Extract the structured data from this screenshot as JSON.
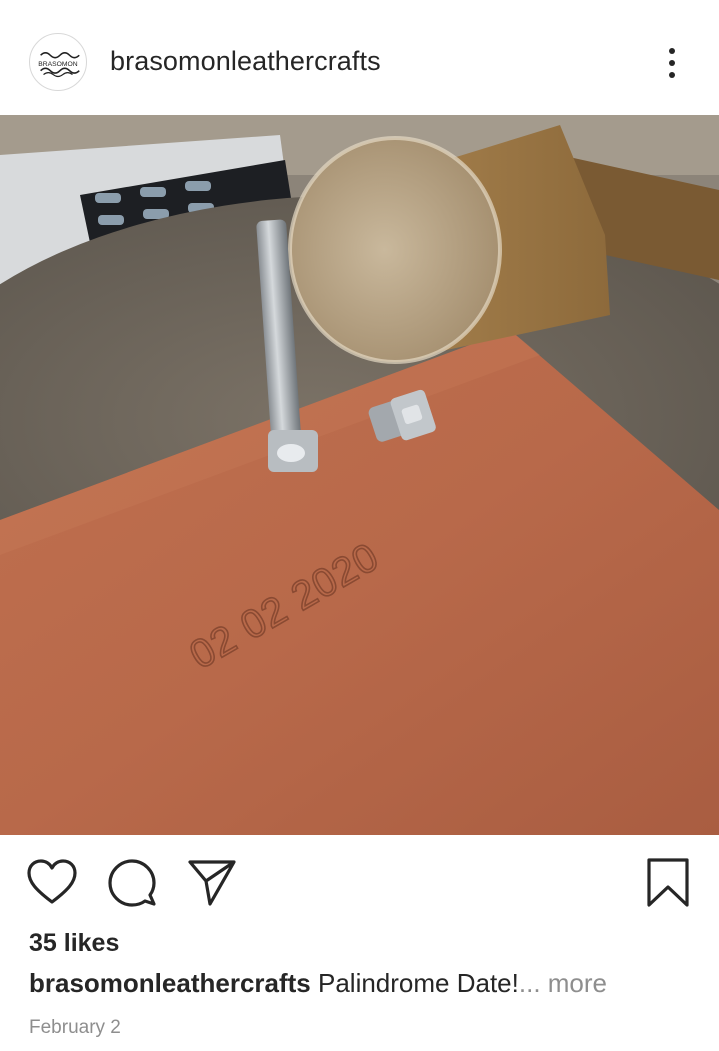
{
  "post": {
    "username": "brasomonleathercrafts",
    "avatar_text": "BRASOMON",
    "photo_stamp_text": "02 02 2020",
    "likes": "35 likes",
    "caption": {
      "username": "brasomonleathercrafts",
      "text": " Palindrome Date!",
      "ellipsis": "...",
      "more": " more"
    },
    "date": "February 2"
  },
  "icons": {
    "more": "more-vertical-icon",
    "like": "heart-icon",
    "comment": "comment-icon",
    "share": "send-icon",
    "save": "bookmark-icon"
  },
  "colors": {
    "text": "#262626",
    "muted": "#8e8e8e",
    "leather": "#b8694a"
  }
}
